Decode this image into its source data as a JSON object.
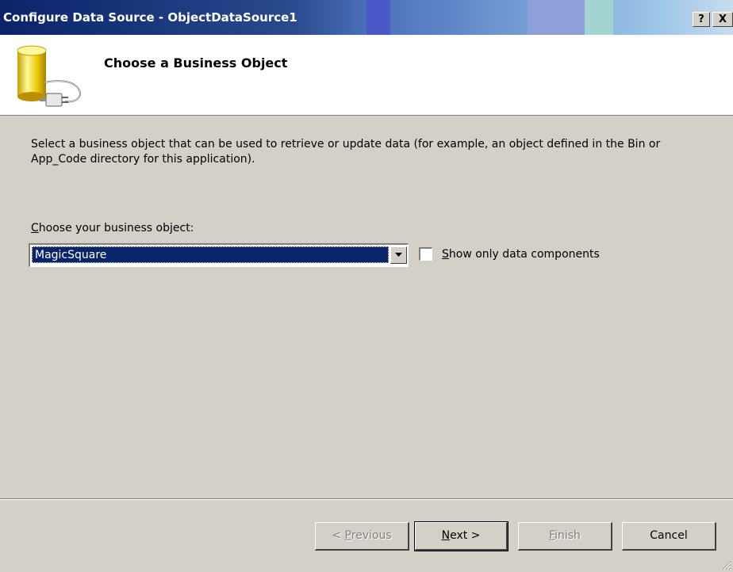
{
  "window": {
    "title": "Configure Data Source - ObjectDataSource1",
    "help_button": "?",
    "close_button": "X"
  },
  "header": {
    "title": "Choose a Business Object",
    "icon": "database-plug-icon"
  },
  "body": {
    "description": "Select a business object that can be used to retrieve or update data (for example, an object defined in the Bin or App_Code directory for this application).",
    "choose_label_accel": "C",
    "choose_label_rest": "hoose your business object:",
    "selected_object": "MagicSquare",
    "show_only_accel": "S",
    "show_only_rest": "how only data components",
    "show_only_checked": false
  },
  "buttons": {
    "previous_prefix": "< ",
    "previous_accel": "P",
    "previous_rest": "revious",
    "next_accel": "N",
    "next_rest": "ext >",
    "finish_accel": "F",
    "finish_rest": "inish",
    "cancel": "Cancel"
  },
  "colors": {
    "titlebar_start": "#0a246a",
    "selection": "#0a246a",
    "dialog_face": "#d4d0c8"
  }
}
